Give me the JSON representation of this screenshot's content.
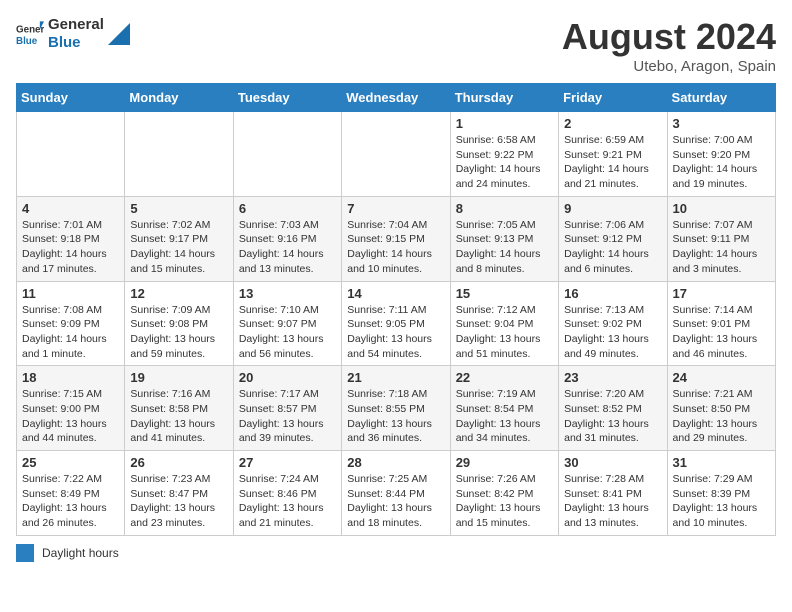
{
  "header": {
    "logo_general": "General",
    "logo_blue": "Blue",
    "month_title": "August 2024",
    "subtitle": "Utebo, Aragon, Spain"
  },
  "weekdays": [
    "Sunday",
    "Monday",
    "Tuesday",
    "Wednesday",
    "Thursday",
    "Friday",
    "Saturday"
  ],
  "weeks": [
    [
      {
        "day": "",
        "info": ""
      },
      {
        "day": "",
        "info": ""
      },
      {
        "day": "",
        "info": ""
      },
      {
        "day": "",
        "info": ""
      },
      {
        "day": "1",
        "info": "Sunrise: 6:58 AM\nSunset: 9:22 PM\nDaylight: 14 hours and 24 minutes."
      },
      {
        "day": "2",
        "info": "Sunrise: 6:59 AM\nSunset: 9:21 PM\nDaylight: 14 hours and 21 minutes."
      },
      {
        "day": "3",
        "info": "Sunrise: 7:00 AM\nSunset: 9:20 PM\nDaylight: 14 hours and 19 minutes."
      }
    ],
    [
      {
        "day": "4",
        "info": "Sunrise: 7:01 AM\nSunset: 9:18 PM\nDaylight: 14 hours and 17 minutes."
      },
      {
        "day": "5",
        "info": "Sunrise: 7:02 AM\nSunset: 9:17 PM\nDaylight: 14 hours and 15 minutes."
      },
      {
        "day": "6",
        "info": "Sunrise: 7:03 AM\nSunset: 9:16 PM\nDaylight: 14 hours and 13 minutes."
      },
      {
        "day": "7",
        "info": "Sunrise: 7:04 AM\nSunset: 9:15 PM\nDaylight: 14 hours and 10 minutes."
      },
      {
        "day": "8",
        "info": "Sunrise: 7:05 AM\nSunset: 9:13 PM\nDaylight: 14 hours and 8 minutes."
      },
      {
        "day": "9",
        "info": "Sunrise: 7:06 AM\nSunset: 9:12 PM\nDaylight: 14 hours and 6 minutes."
      },
      {
        "day": "10",
        "info": "Sunrise: 7:07 AM\nSunset: 9:11 PM\nDaylight: 14 hours and 3 minutes."
      }
    ],
    [
      {
        "day": "11",
        "info": "Sunrise: 7:08 AM\nSunset: 9:09 PM\nDaylight: 14 hours and 1 minute."
      },
      {
        "day": "12",
        "info": "Sunrise: 7:09 AM\nSunset: 9:08 PM\nDaylight: 13 hours and 59 minutes."
      },
      {
        "day": "13",
        "info": "Sunrise: 7:10 AM\nSunset: 9:07 PM\nDaylight: 13 hours and 56 minutes."
      },
      {
        "day": "14",
        "info": "Sunrise: 7:11 AM\nSunset: 9:05 PM\nDaylight: 13 hours and 54 minutes."
      },
      {
        "day": "15",
        "info": "Sunrise: 7:12 AM\nSunset: 9:04 PM\nDaylight: 13 hours and 51 minutes."
      },
      {
        "day": "16",
        "info": "Sunrise: 7:13 AM\nSunset: 9:02 PM\nDaylight: 13 hours and 49 minutes."
      },
      {
        "day": "17",
        "info": "Sunrise: 7:14 AM\nSunset: 9:01 PM\nDaylight: 13 hours and 46 minutes."
      }
    ],
    [
      {
        "day": "18",
        "info": "Sunrise: 7:15 AM\nSunset: 9:00 PM\nDaylight: 13 hours and 44 minutes."
      },
      {
        "day": "19",
        "info": "Sunrise: 7:16 AM\nSunset: 8:58 PM\nDaylight: 13 hours and 41 minutes."
      },
      {
        "day": "20",
        "info": "Sunrise: 7:17 AM\nSunset: 8:57 PM\nDaylight: 13 hours and 39 minutes."
      },
      {
        "day": "21",
        "info": "Sunrise: 7:18 AM\nSunset: 8:55 PM\nDaylight: 13 hours and 36 minutes."
      },
      {
        "day": "22",
        "info": "Sunrise: 7:19 AM\nSunset: 8:54 PM\nDaylight: 13 hours and 34 minutes."
      },
      {
        "day": "23",
        "info": "Sunrise: 7:20 AM\nSunset: 8:52 PM\nDaylight: 13 hours and 31 minutes."
      },
      {
        "day": "24",
        "info": "Sunrise: 7:21 AM\nSunset: 8:50 PM\nDaylight: 13 hours and 29 minutes."
      }
    ],
    [
      {
        "day": "25",
        "info": "Sunrise: 7:22 AM\nSunset: 8:49 PM\nDaylight: 13 hours and 26 minutes."
      },
      {
        "day": "26",
        "info": "Sunrise: 7:23 AM\nSunset: 8:47 PM\nDaylight: 13 hours and 23 minutes."
      },
      {
        "day": "27",
        "info": "Sunrise: 7:24 AM\nSunset: 8:46 PM\nDaylight: 13 hours and 21 minutes."
      },
      {
        "day": "28",
        "info": "Sunrise: 7:25 AM\nSunset: 8:44 PM\nDaylight: 13 hours and 18 minutes."
      },
      {
        "day": "29",
        "info": "Sunrise: 7:26 AM\nSunset: 8:42 PM\nDaylight: 13 hours and 15 minutes."
      },
      {
        "day": "30",
        "info": "Sunrise: 7:28 AM\nSunset: 8:41 PM\nDaylight: 13 hours and 13 minutes."
      },
      {
        "day": "31",
        "info": "Sunrise: 7:29 AM\nSunset: 8:39 PM\nDaylight: 13 hours and 10 minutes."
      }
    ]
  ],
  "legend": {
    "text": "Daylight hours"
  }
}
